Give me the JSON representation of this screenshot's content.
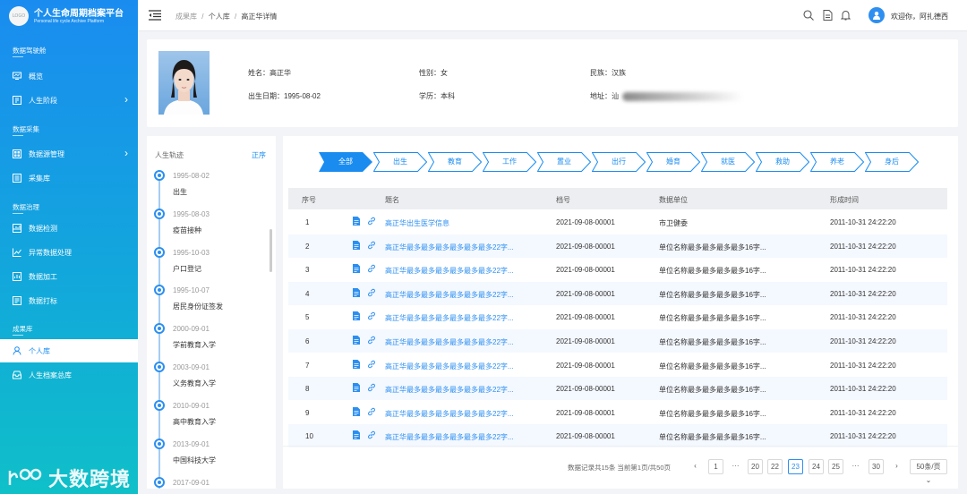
{
  "app": {
    "title": "个人生命周期档案平台",
    "subtitle": "Personal life cycle Archive Platform",
    "logo_text": "LOGO",
    "watermark": "大数跨境"
  },
  "sidebar": {
    "sections": [
      "数据驾驶舱",
      "数据采集",
      "数据治理",
      "成果库"
    ],
    "items": [
      {
        "label": "概览",
        "icon": "monitor-icon"
      },
      {
        "label": "人生阶段",
        "icon": "stage-icon",
        "arrow": "›"
      },
      {
        "label": "数据源管理",
        "icon": "database-icon",
        "arrow": "›"
      },
      {
        "label": "采集库",
        "icon": "collect-icon"
      },
      {
        "label": "数据检测",
        "icon": "inspect-icon"
      },
      {
        "label": "异常数据处理",
        "icon": "chart-icon"
      },
      {
        "label": "数据加工",
        "icon": "process-icon"
      },
      {
        "label": "数据打标",
        "icon": "tag-icon"
      },
      {
        "label": "个人库",
        "icon": "person-icon"
      },
      {
        "label": "人生档案总库",
        "icon": "archive-icon"
      }
    ]
  },
  "topbar": {
    "breadcrumb": [
      "成果库",
      "个人库",
      "高正华详情"
    ],
    "sep": "/",
    "welcome": "欢迎你，阿扎德西",
    "icons": [
      "search-icon",
      "document-icon",
      "bell-icon"
    ]
  },
  "profile": {
    "name_label": "姓名：高正华",
    "gender_label": "性别：女",
    "ethnicity_label": "民族：汉族",
    "birth_label": "出生日期：1995-08-02",
    "edu_label": "学历：本科",
    "addr_label": "地址：",
    "addr_prefix": "汕"
  },
  "timeline": {
    "title": "人生轨迹",
    "sort": "正序",
    "events": [
      {
        "date": "1995-08-02",
        "event": "出生"
      },
      {
        "date": "1995-08-03",
        "event": "疫苗接种"
      },
      {
        "date": "1995-10-03",
        "event": "户口登记"
      },
      {
        "date": "1995-10-07",
        "event": "居民身份证签发"
      },
      {
        "date": "2000-09-01",
        "event": "学前教育入学"
      },
      {
        "date": "2003-09-01",
        "event": "义务教育入学"
      },
      {
        "date": "2010-09-01",
        "event": "高中教育入学"
      },
      {
        "date": "2013-09-01",
        "event": "中国科技大学"
      },
      {
        "date": "2017-09-01",
        "event": ""
      }
    ]
  },
  "steps": [
    "全部",
    "出生",
    "教育",
    "工作",
    "置业",
    "出行",
    "婚育",
    "就医",
    "救助",
    "养老",
    "身后"
  ],
  "table": {
    "headers": [
      "序号",
      "题名",
      "档号",
      "数据单位",
      "形成时间"
    ],
    "rows": [
      {
        "no": "1",
        "title": "高正华出生医学信息",
        "code": "2021-09-08-00001",
        "unit": "市卫健委",
        "time": "2011-10-31 24:22:20"
      },
      {
        "no": "2",
        "title": "高正华最多最多最多最多最多最多22字...",
        "code": "2021-09-08-00001",
        "unit": "单位名称最多最多最多最多16字...",
        "time": "2011-10-31 24:22:20"
      },
      {
        "no": "3",
        "title": "高正华最多最多最多最多最多最多22字...",
        "code": "2021-09-08-00001",
        "unit": "单位名称最多最多最多最多16字...",
        "time": "2011-10-31 24:22:20"
      },
      {
        "no": "4",
        "title": "高正华最多最多最多最多最多最多22字...",
        "code": "2021-09-08-00001",
        "unit": "单位名称最多最多最多最多16字...",
        "time": "2011-10-31 24:22:20"
      },
      {
        "no": "5",
        "title": "高正华最多最多最多最多最多最多22字...",
        "code": "2021-09-08-00001",
        "unit": "单位名称最多最多最多最多16字...",
        "time": "2011-10-31 24:22:20"
      },
      {
        "no": "6",
        "title": "高正华最多最多最多最多最多最多22字...",
        "code": "2021-09-08-00001",
        "unit": "单位名称最多最多最多最多16字...",
        "time": "2011-10-31 24:22:20"
      },
      {
        "no": "7",
        "title": "高正华最多最多最多最多最多最多22字...",
        "code": "2021-09-08-00001",
        "unit": "单位名称最多最多最多最多16字...",
        "time": "2011-10-31 24:22:20"
      },
      {
        "no": "8",
        "title": "高正华最多最多最多最多最多最多22字...",
        "code": "2021-09-08-00001",
        "unit": "单位名称最多最多最多最多16字...",
        "time": "2011-10-31 24:22:20"
      },
      {
        "no": "9",
        "title": "高正华最多最多最多最多最多最多22字...",
        "code": "2021-09-08-00001",
        "unit": "单位名称最多最多最多最多16字...",
        "time": "2011-10-31 24:22:20"
      },
      {
        "no": "10",
        "title": "高正华最多最多最多最多最多最多22字...",
        "code": "2021-09-08-00001",
        "unit": "单位名称最多最多最多最多16字...",
        "time": "2011-10-31 24:22:20"
      }
    ]
  },
  "pagination": {
    "summary": "数据记录共15条 当前第1页/共50页",
    "prev": "‹",
    "next": "›",
    "pages": [
      "1",
      "···",
      "20",
      "22",
      "23",
      "24",
      "25",
      "···",
      "30"
    ],
    "current": "23",
    "page_size": "50条/页 ⌄"
  },
  "colors": {
    "primary": "#1a8cf0",
    "sidebar_end": "#0fc0c8",
    "link": "#2c8ff0"
  }
}
